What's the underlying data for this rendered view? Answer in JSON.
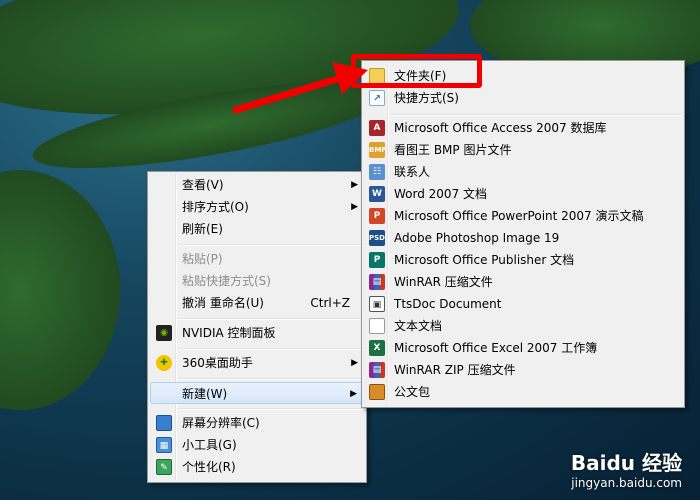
{
  "context_menu": {
    "items": [
      {
        "label": "查看(V)",
        "submenu": true
      },
      {
        "label": "排序方式(O)",
        "submenu": true
      },
      {
        "label": "刷新(E)"
      },
      {
        "label": "粘贴(P)",
        "disabled": true
      },
      {
        "label": "粘贴快捷方式(S)",
        "disabled": true
      },
      {
        "label": "撤消 重命名(U)",
        "shortcut": "Ctrl+Z"
      },
      {
        "label": "NVIDIA 控制面板",
        "icon": "nvidia-icon"
      },
      {
        "label": "360桌面助手",
        "icon": "360-icon",
        "submenu": true
      },
      {
        "label": "新建(W)",
        "submenu": true,
        "highlighted": true
      },
      {
        "label": "屏幕分辨率(C)",
        "icon": "display-icon"
      },
      {
        "label": "小工具(G)",
        "icon": "gadgets-icon"
      },
      {
        "label": "个性化(R)",
        "icon": "personalize-icon"
      }
    ]
  },
  "new_submenu": {
    "items": [
      {
        "label": "文件夹(F)",
        "icon": "folder-icon"
      },
      {
        "label": "快捷方式(S)",
        "icon": "shortcut-icon"
      },
      {
        "label": "Microsoft Office Access 2007 数据库",
        "icon": "access-icon"
      },
      {
        "label": "看图王 BMP 图片文件",
        "icon": "bmp-icon"
      },
      {
        "label": "联系人",
        "icon": "contact-icon"
      },
      {
        "label": "Word 2007 文档",
        "icon": "word-icon"
      },
      {
        "label": "Microsoft Office PowerPoint 2007 演示文稿",
        "icon": "powerpoint-icon"
      },
      {
        "label": "Adobe Photoshop Image 19",
        "icon": "photoshop-icon"
      },
      {
        "label": "Microsoft Office Publisher 文档",
        "icon": "publisher-icon"
      },
      {
        "label": "WinRAR 压缩文件",
        "icon": "winrar-icon"
      },
      {
        "label": "TtsDoc Document",
        "icon": "ttsdoc-icon"
      },
      {
        "label": "文本文档",
        "icon": "text-document-icon"
      },
      {
        "label": "Microsoft Office Excel 2007 工作簿",
        "icon": "excel-icon"
      },
      {
        "label": "WinRAR ZIP 压缩文件",
        "icon": "winrar-zip-icon"
      },
      {
        "label": "公文包",
        "icon": "briefcase-icon"
      }
    ]
  },
  "icon_text": {
    "bmp": "BMP",
    "psd": "PSD"
  },
  "watermark": {
    "logo": "Baidu 经验",
    "url": "jingyan.baidu.com"
  },
  "colors": {
    "annotation": "#f20000",
    "menu_bg": "#f0f0f0"
  }
}
